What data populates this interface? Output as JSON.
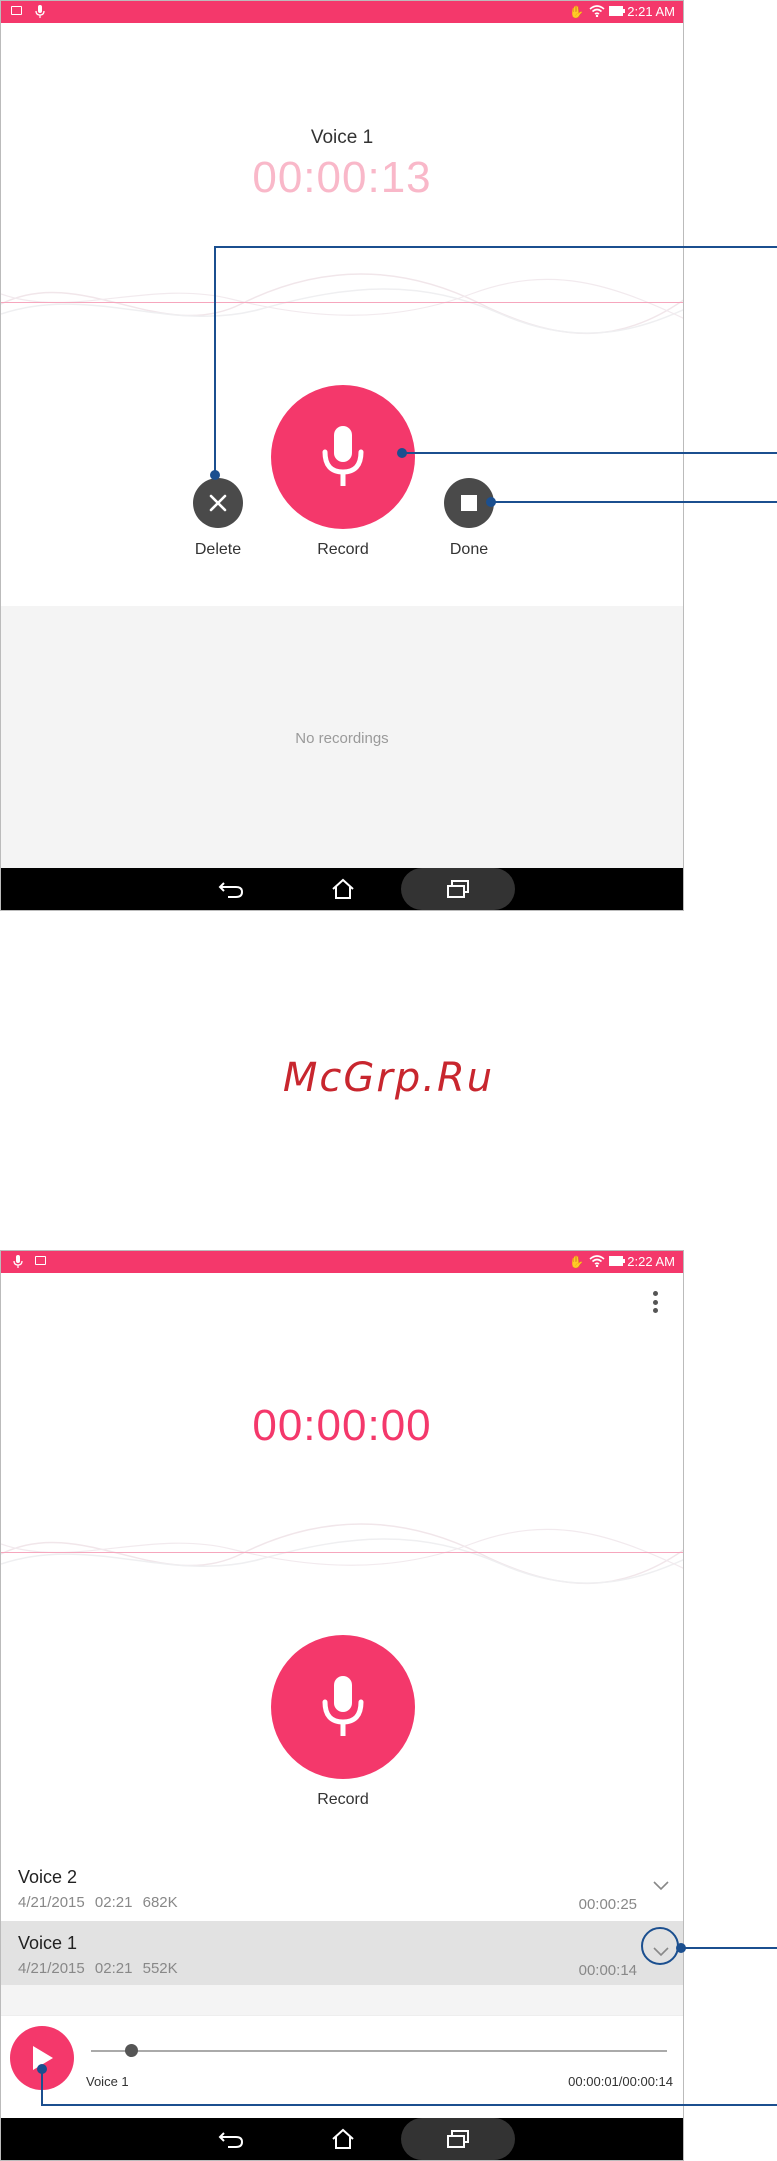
{
  "screen1": {
    "status_time": "2:21 AM",
    "recording_title": "Voice 1",
    "timer": "00:00:13",
    "delete_label": "Delete",
    "record_label": "Record",
    "done_label": "Done",
    "empty_list_text": "No recordings"
  },
  "watermark": "McGrp.Ru",
  "screen2": {
    "status_time": "2:22 AM",
    "timer": "00:00:00",
    "record_label": "Record",
    "recordings": [
      {
        "name": "Voice 2",
        "date": "4/21/2015 02:21",
        "size": "682K",
        "duration": "00:00:25"
      },
      {
        "name": "Voice 1",
        "date": "4/21/2015 02:21",
        "size": "552K",
        "duration": "00:00:14"
      }
    ],
    "player": {
      "track_name": "Voice 1",
      "time": "00:00:01/00:00:14",
      "progress": 0.07
    }
  },
  "icons": {
    "status": [
      "image-icon",
      "mic-icon",
      "hand-icon",
      "wifi-icon",
      "battery-icon"
    ],
    "nav": [
      "back-icon",
      "home-icon",
      "recents-icon"
    ]
  },
  "colors": {
    "accent": "#f4386b",
    "accent_faded": "#f9b8c9",
    "callout": "#1b4f8f",
    "watermark": "#c8262e"
  }
}
